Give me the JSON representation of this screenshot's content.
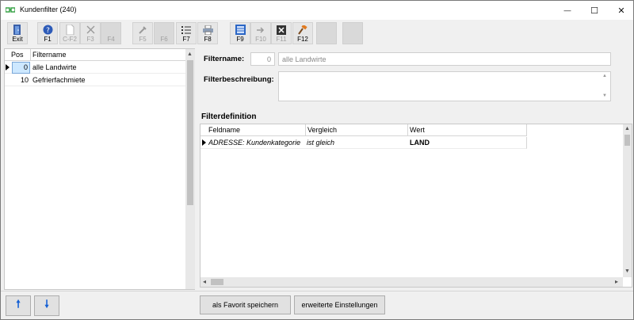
{
  "window": {
    "title": "Kundenfilter (240)",
    "minimize_glyph": "—",
    "maximize_glyph": "☐",
    "close_glyph": "✕"
  },
  "toolbar": {
    "buttons": [
      {
        "label": "Exit",
        "icon": "exit-door-icon",
        "enabled": true
      },
      {
        "label": "F1",
        "icon": "help-icon",
        "enabled": true
      },
      {
        "label": "C-F2",
        "icon": "new-document-icon",
        "enabled": false
      },
      {
        "label": "F3",
        "icon": "delete-x-icon",
        "enabled": false
      },
      {
        "label": "F4",
        "icon": "blank-icon",
        "enabled": false
      },
      {
        "label": "F5",
        "icon": "tools-icon",
        "enabled": false
      },
      {
        "label": "F6",
        "icon": "blank-icon",
        "enabled": false
      },
      {
        "label": "F7",
        "icon": "list-icon",
        "enabled": true
      },
      {
        "label": "F8",
        "icon": "printer-icon",
        "enabled": true
      },
      {
        "label": "F9",
        "icon": "filter-sheet-icon",
        "enabled": true
      },
      {
        "label": "F10",
        "icon": "arrow-icon",
        "enabled": false
      },
      {
        "label": "F11",
        "icon": "excel-icon",
        "enabled": false
      },
      {
        "label": "F12",
        "icon": "hammer-icon",
        "enabled": true
      }
    ]
  },
  "filter_list": {
    "columns": [
      "Pos",
      "Filtername"
    ],
    "rows": [
      {
        "pos": "0",
        "name": "alle Landwirte",
        "selected": true
      },
      {
        "pos": "10",
        "name": "Gefrierfachmiete",
        "selected": false
      }
    ]
  },
  "details": {
    "name_label": "Filtername:",
    "pos_value": "0",
    "name_value": "alle Landwirte",
    "desc_label": "Filterbeschreibung:",
    "desc_value": "",
    "section_title": "Filterdefinition"
  },
  "definition_grid": {
    "columns": [
      "Feldname",
      "Vergleich",
      "Wert"
    ],
    "rows": [
      {
        "field": "ADRESSE: Kundenkategorie",
        "compare": "ist gleich",
        "value": "LAND"
      }
    ]
  },
  "bottom": {
    "up_glyph": "🠕",
    "down_glyph": "🠗",
    "favorite_button": "als Favorit speichern",
    "advanced_button": "erweiterte Einstellungen"
  },
  "colors": {
    "selection": "#cde8ff",
    "accent_blue": "#1560d4"
  }
}
